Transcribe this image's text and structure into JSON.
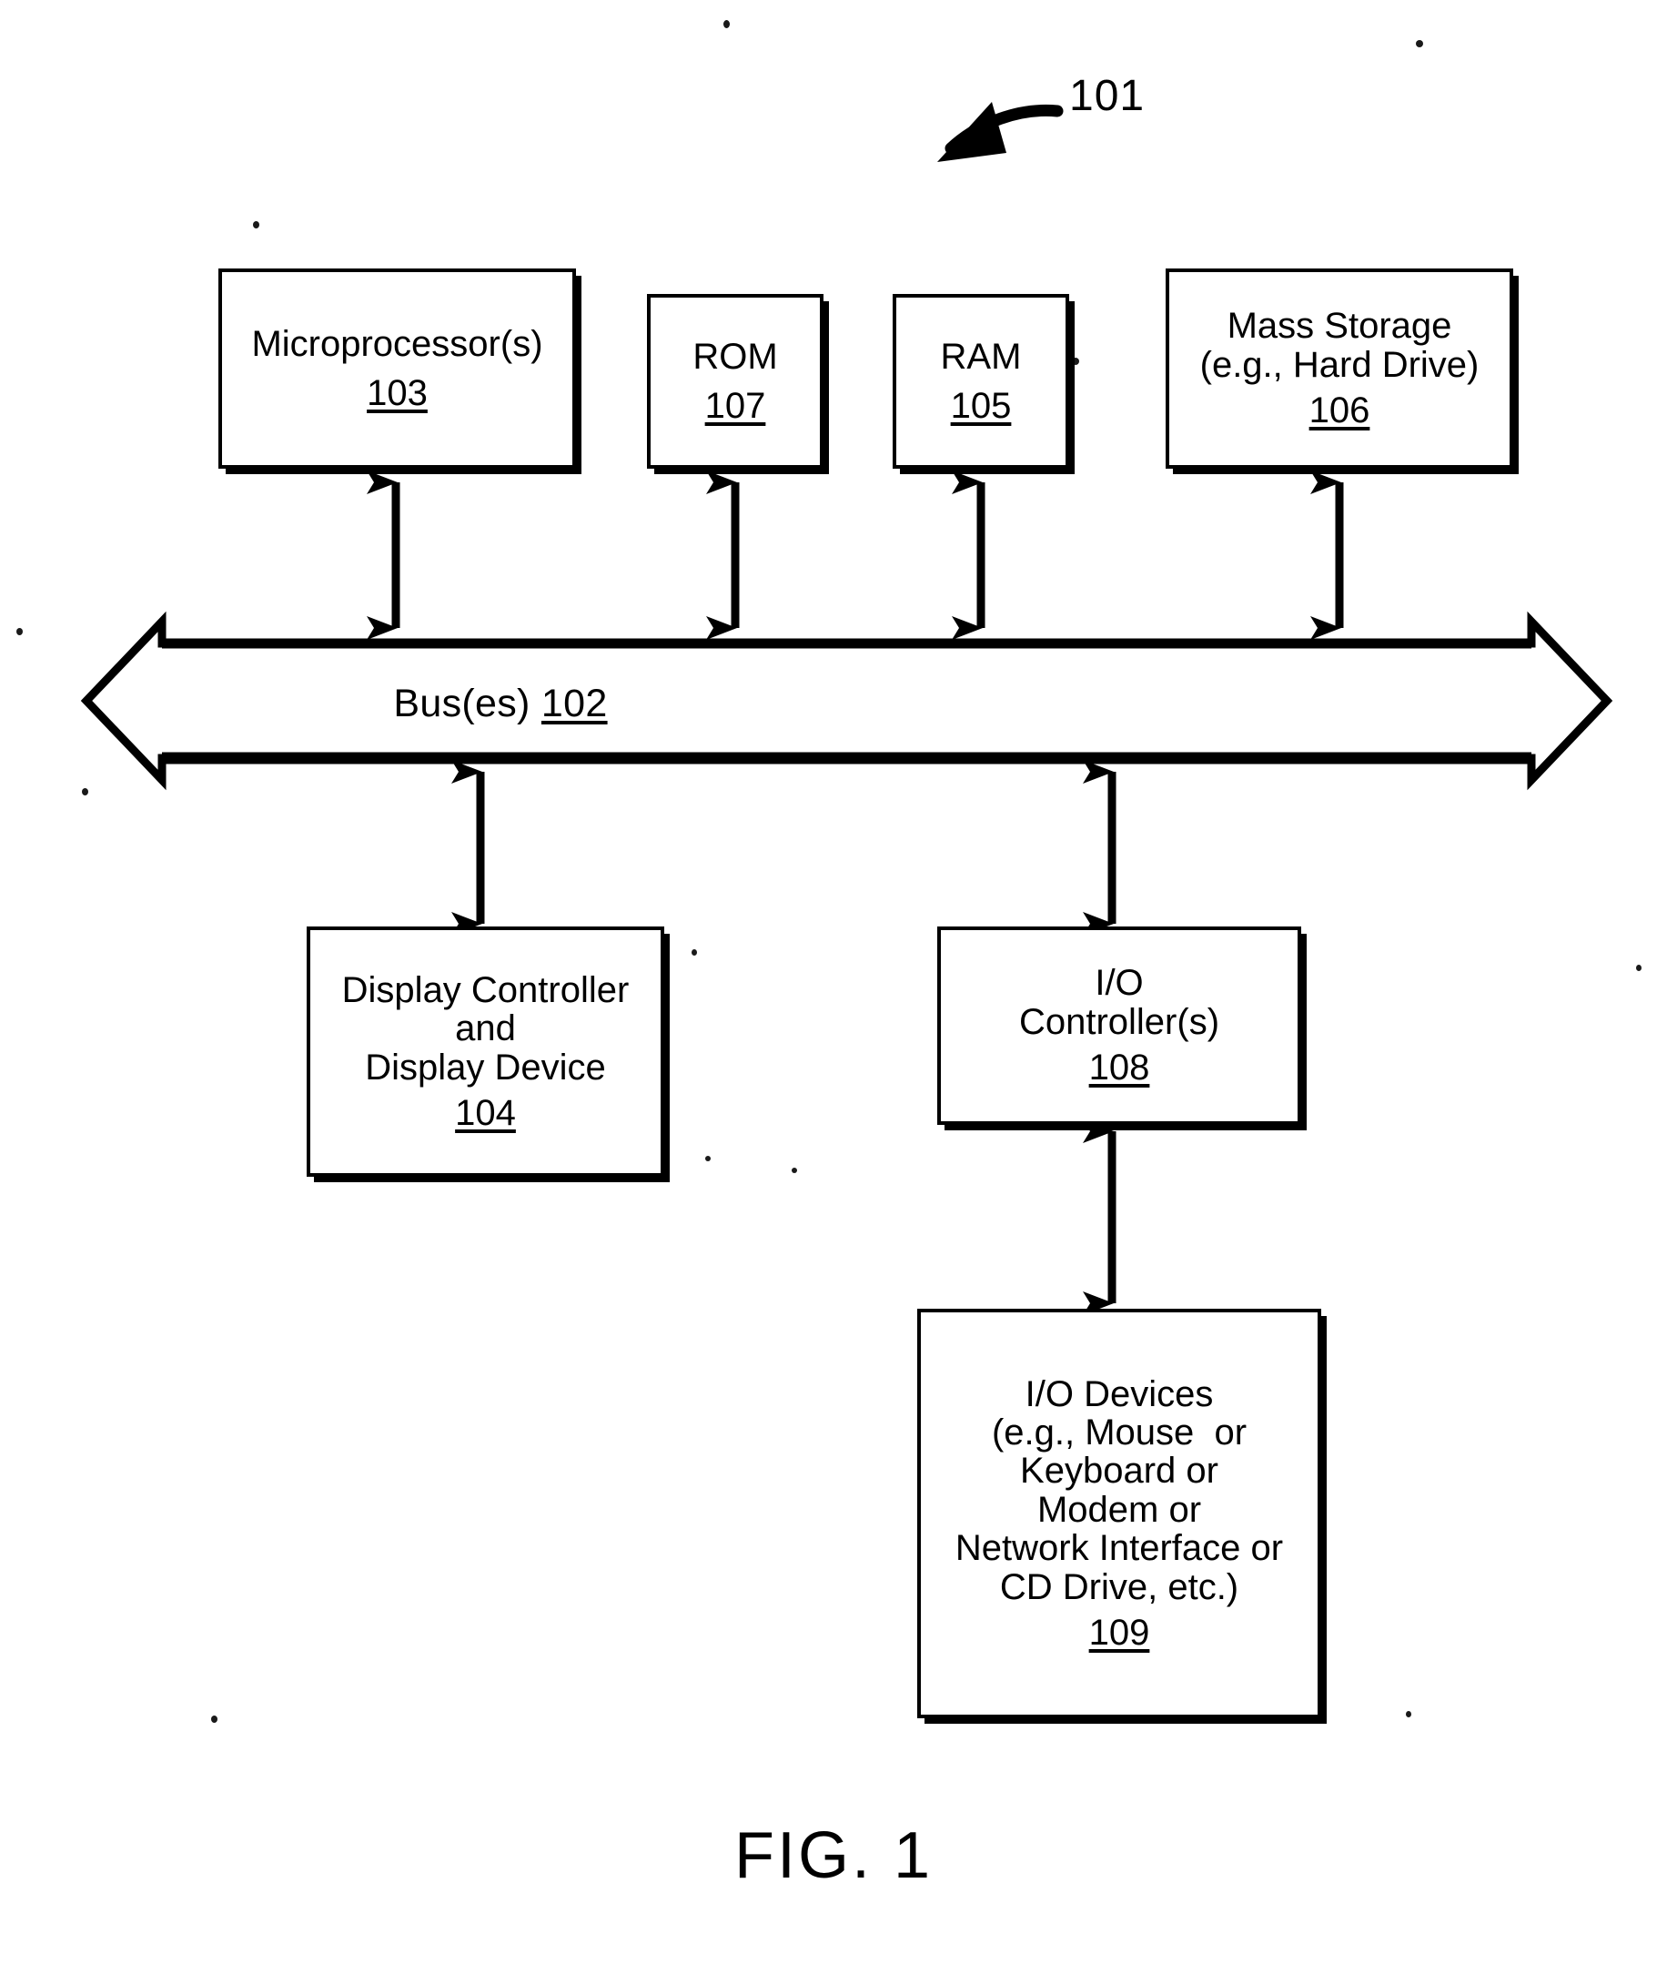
{
  "figure": {
    "caption": "FIG. 1",
    "system_callout": "101",
    "type": "block-diagram",
    "background_color": "#ffffff",
    "line_color": "#000000"
  },
  "bus": {
    "label": "Bus(es) ",
    "ref": "102",
    "style": "double-headed-horizontal-arrow"
  },
  "blocks": [
    {
      "id": "microprocessor",
      "lines": [
        "Microprocessor(s)"
      ],
      "ref": "103"
    },
    {
      "id": "rom",
      "lines": [
        "ROM"
      ],
      "ref": "107"
    },
    {
      "id": "ram",
      "lines": [
        "RAM"
      ],
      "ref": "105"
    },
    {
      "id": "mass-storage",
      "lines": [
        "Mass Storage",
        "(e.g., Hard Drive)"
      ],
      "ref": "106"
    },
    {
      "id": "display-controller",
      "lines": [
        "Display Controller",
        "and",
        "Display Device"
      ],
      "ref": "104"
    },
    {
      "id": "io-controller",
      "lines": [
        "I/O",
        "Controller(s)"
      ],
      "ref": "108"
    },
    {
      "id": "io-devices",
      "lines": [
        "I/O Devices",
        "(e.g., Mouse  or",
        "Keyboard or",
        "Modem or",
        "Network Interface or",
        "CD Drive, etc.)"
      ],
      "ref": "109"
    }
  ],
  "connections": [
    {
      "id": "microprocessor-bus",
      "from": "microprocessor",
      "to": "bus",
      "style": "double-headed-arrow"
    },
    {
      "id": "rom-bus",
      "from": "rom",
      "to": "bus",
      "style": "double-headed-arrow"
    },
    {
      "id": "ram-bus",
      "from": "ram",
      "to": "bus",
      "style": "double-headed-arrow"
    },
    {
      "id": "mass-storage-bus",
      "from": "mass-storage",
      "to": "bus",
      "style": "double-headed-arrow"
    },
    {
      "id": "bus-display-controller",
      "from": "bus",
      "to": "display-controller",
      "style": "double-headed-arrow"
    },
    {
      "id": "bus-io-controller",
      "from": "bus",
      "to": "io-controller",
      "style": "double-headed-arrow"
    },
    {
      "id": "io-controller-io-devices",
      "from": "io-controller",
      "to": "io-devices",
      "style": "double-headed-arrow"
    }
  ]
}
